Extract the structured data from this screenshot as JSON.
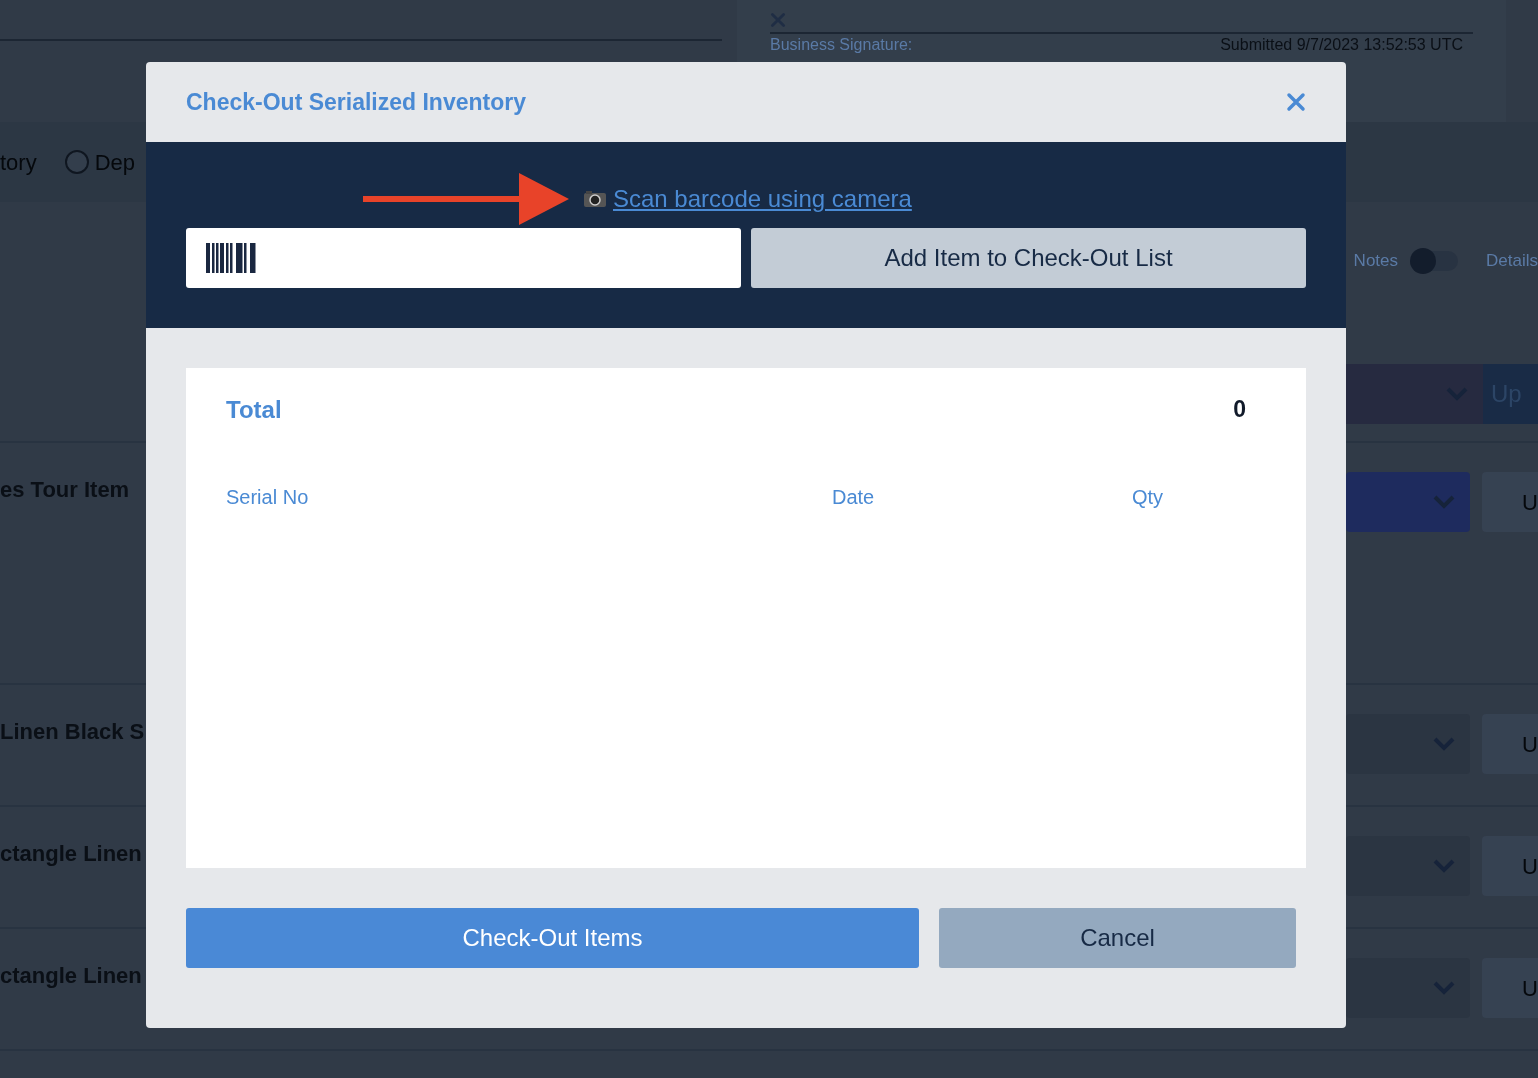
{
  "background": {
    "signature_label": "Business Signature:",
    "submitted": "Submitted 9/7/2023 13:52:53 UTC",
    "filter": {
      "cut_label": "tory",
      "radio": {
        "label": "Dep",
        "selected": false
      }
    },
    "notes_toggle": {
      "label": "Notes",
      "on": false
    },
    "details_label": "Details",
    "header_button": "Up",
    "items": [
      {
        "name": "es Tour Item",
        "button": "U",
        "highlighted": true
      },
      {
        "name": "Linen Black S",
        "button": "U",
        "highlighted": false
      },
      {
        "name": "ctangle Linen",
        "button": "U",
        "highlighted": false
      },
      {
        "name": "ctangle Linen",
        "button": "U",
        "highlighted": false
      }
    ]
  },
  "modal": {
    "title": "Check-Out Serialized Inventory",
    "scan_link": "Scan barcode using camera",
    "add_button": "Add Item to Check-Out List",
    "total_label": "Total",
    "total_value": "0",
    "columns": [
      "Serial No",
      "Date",
      "Qty"
    ],
    "checkout_button": "Check-Out Items",
    "cancel_button": "Cancel"
  }
}
